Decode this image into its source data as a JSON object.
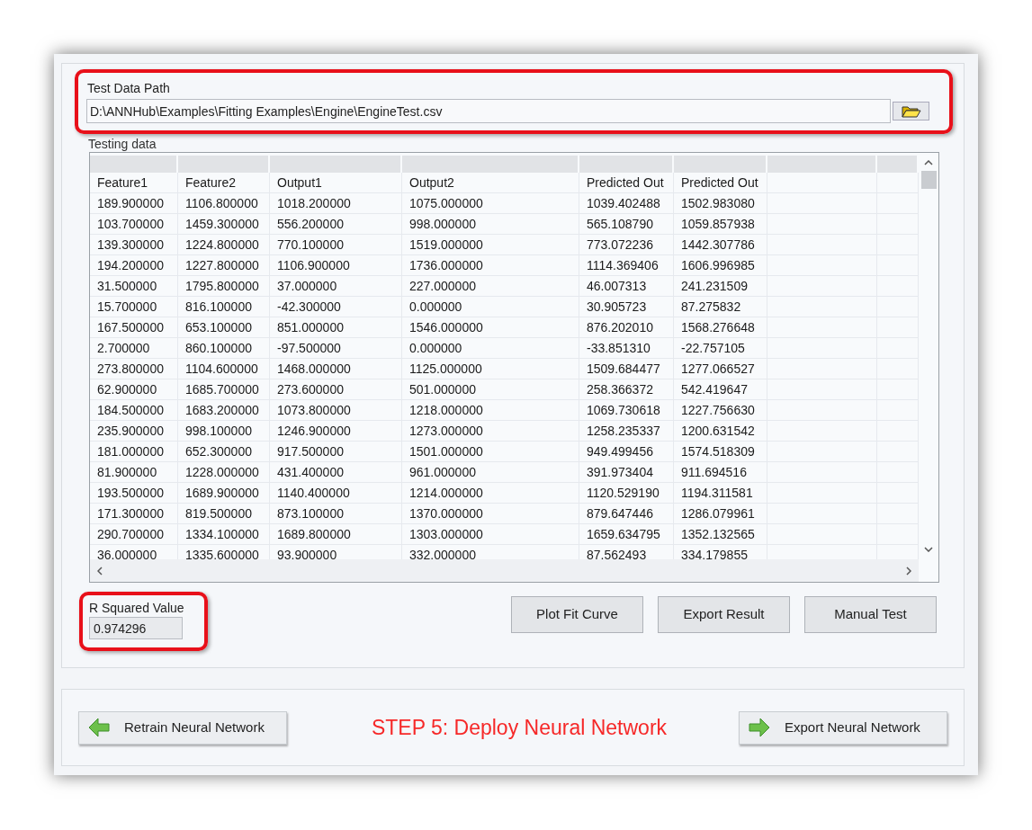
{
  "path_field": {
    "label": "Test Data Path",
    "value": "D:\\ANNHub\\Examples\\Fitting Examples\\Engine\\EngineTest.csv"
  },
  "table": {
    "label": "Testing data",
    "columns": [
      "Feature1",
      "Feature2",
      "Output1",
      "Output2",
      "Predicted Out",
      "Predicted Out"
    ],
    "rows": [
      [
        "189.900000",
        "1106.800000",
        "1018.200000",
        "1075.000000",
        "1039.402488",
        "1502.983080"
      ],
      [
        "103.700000",
        "1459.300000",
        "556.200000",
        "998.000000",
        "565.108790",
        "1059.857938"
      ],
      [
        "139.300000",
        "1224.800000",
        "770.100000",
        "1519.000000",
        "773.072236",
        "1442.307786"
      ],
      [
        "194.200000",
        "1227.800000",
        "1106.900000",
        "1736.000000",
        "1114.369406",
        "1606.996985"
      ],
      [
        "31.500000",
        "1795.800000",
        "37.000000",
        "227.000000",
        "46.007313",
        "241.231509"
      ],
      [
        "15.700000",
        "816.100000",
        "-42.300000",
        "0.000000",
        "30.905723",
        "87.275832"
      ],
      [
        "167.500000",
        "653.100000",
        "851.000000",
        "1546.000000",
        "876.202010",
        "1568.276648"
      ],
      [
        "2.700000",
        "860.100000",
        "-97.500000",
        "0.000000",
        "-33.851310",
        "-22.757105"
      ],
      [
        "273.800000",
        "1104.600000",
        "1468.000000",
        "1125.000000",
        "1509.684477",
        "1277.066527"
      ],
      [
        "62.900000",
        "1685.700000",
        "273.600000",
        "501.000000",
        "258.366372",
        "542.419647"
      ],
      [
        "184.500000",
        "1683.200000",
        "1073.800000",
        "1218.000000",
        "1069.730618",
        "1227.756630"
      ],
      [
        "235.900000",
        "998.100000",
        "1246.900000",
        "1273.000000",
        "1258.235337",
        "1200.631542"
      ],
      [
        "181.000000",
        "652.300000",
        "917.500000",
        "1501.000000",
        "949.499456",
        "1574.518309"
      ],
      [
        "81.900000",
        "1228.000000",
        "431.400000",
        "961.000000",
        "391.973404",
        "911.694516"
      ],
      [
        "193.500000",
        "1689.900000",
        "1140.400000",
        "1214.000000",
        "1120.529190",
        "1194.311581"
      ],
      [
        "171.300000",
        "819.500000",
        "873.100000",
        "1370.000000",
        "879.647446",
        "1286.079961"
      ],
      [
        "290.700000",
        "1334.100000",
        "1689.800000",
        "1303.000000",
        "1659.634795",
        "1352.132565"
      ],
      [
        "36.000000",
        "1335.600000",
        "93.900000",
        "332.000000",
        "87.562493",
        "334.179855"
      ]
    ]
  },
  "r_squared": {
    "label": "R Squared Value",
    "value": "0.974296"
  },
  "actions": [
    "Plot Fit Curve",
    "Export Result",
    "Manual Test"
  ],
  "footer": {
    "back_button": "Retrain Neural Network",
    "step_title": "STEP 5: Deploy Neural Network",
    "next_button": "Export Neural Network"
  }
}
